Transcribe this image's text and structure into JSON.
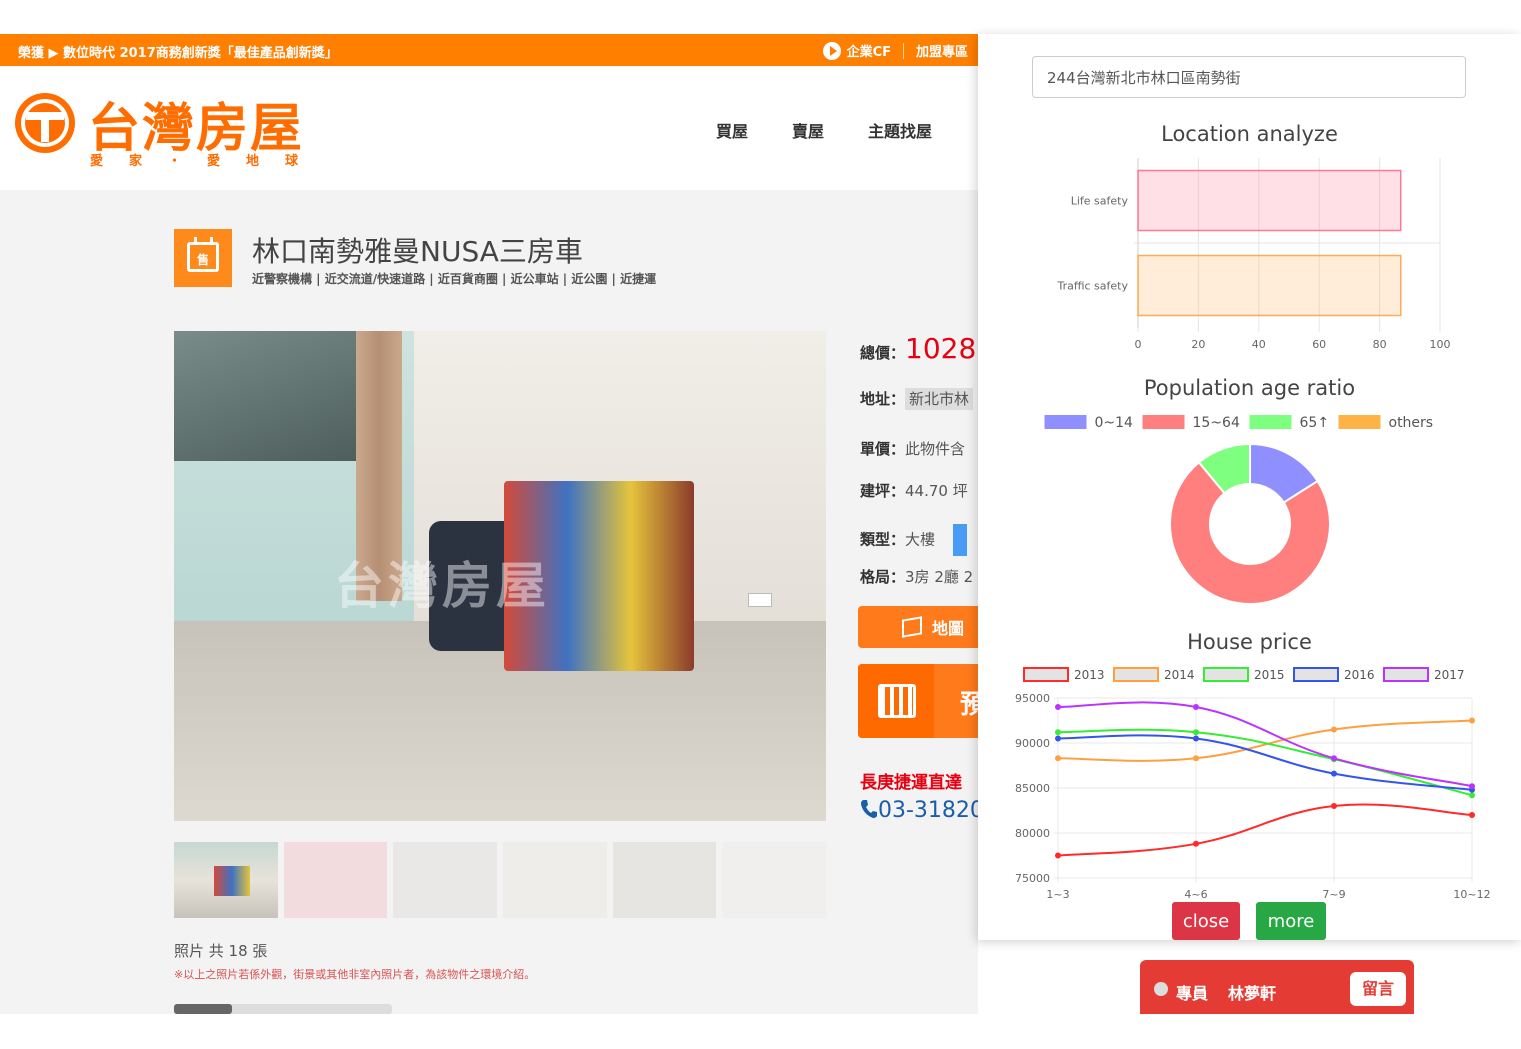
{
  "site": {
    "topbar": {
      "news": "榮獲 ▶ 數位時代 2017商務創新獎「最佳產品創新獎」",
      "cf_label": "企業CF",
      "join_label": "加盟專區"
    },
    "logo": {
      "name": "台灣房屋",
      "tagline": "愛家・愛地球"
    },
    "nav": [
      "買屋",
      "賣屋",
      "主題找屋"
    ],
    "listing": {
      "badge": "售",
      "title": "林口南勢雅曼NUSA三房車",
      "tags": "近警察機構 | 近交流道/快速道路 | 近百貨商圈 | 近公車站 | 近公園 | 近捷運",
      "watermark": "台灣房屋",
      "photo_count": "照片 共 18 張",
      "photo_note": "※以上之照片若係外觀，街景或其他非室內照片者，為該物件之環境介紹。",
      "price_label": "總價：",
      "price_value": "1028",
      "address_label": "地址：",
      "address_value": "新北市林",
      "unit_price_label": "單價：",
      "unit_price_value": "此物件含",
      "area_label": "建坪：",
      "area_value": "44.70 坪",
      "type_label": "類型：",
      "type_value": "大樓",
      "layout_label": "格局：",
      "layout_value": "3房 2廳 2",
      "map_button": "地圖",
      "reserve_button": "預",
      "mrt": "長庚捷運直達",
      "phone": "03-31820"
    },
    "agent": {
      "role": "專員",
      "name": "林夢軒",
      "message_button": "留言"
    }
  },
  "panel": {
    "address_input": "244台灣新北市林口區南勢街",
    "close_button": "close",
    "more_button": "more"
  },
  "chart_data": [
    {
      "type": "bar",
      "orientation": "horizontal",
      "title": "Location analyze",
      "categories": [
        "Life safety",
        "Traffic safety"
      ],
      "values": [
        87,
        87
      ],
      "xlim": [
        0,
        100
      ],
      "ticks": [
        0,
        20,
        40,
        60,
        80,
        100
      ],
      "colors": [
        "#ff6384",
        "#ff9f40"
      ]
    },
    {
      "type": "pie",
      "variant": "doughnut",
      "title": "Population age ratio",
      "labels": [
        "0~14",
        "15~64",
        "65↑",
        "others"
      ],
      "values": [
        16,
        73,
        11,
        0
      ],
      "colors": [
        "#8f8fff",
        "#ff7f7f",
        "#7fff7f",
        "#ffb347"
      ],
      "legend": "top"
    },
    {
      "type": "line",
      "title": "House price",
      "categories": [
        "1~3",
        "4~6",
        "7~9",
        "10~12"
      ],
      "ylim": [
        75000,
        95000
      ],
      "yticks": [
        75000,
        80000,
        85000,
        90000,
        95000
      ],
      "legend": "top",
      "series": [
        {
          "name": "2013",
          "color": "#ff2a2a",
          "values": [
            77500,
            78800,
            83000,
            82000
          ]
        },
        {
          "name": "2014",
          "color": "#ffa040",
          "values": [
            88300,
            88300,
            91500,
            92500
          ]
        },
        {
          "name": "2015",
          "color": "#33ee33",
          "values": [
            91200,
            91200,
            88200,
            84200
          ]
        },
        {
          "name": "2016",
          "color": "#3355ee",
          "values": [
            90500,
            90500,
            86600,
            84800
          ]
        },
        {
          "name": "2017",
          "color": "#bb33ff",
          "values": [
            94000,
            94000,
            88300,
            85200
          ]
        }
      ]
    }
  ]
}
